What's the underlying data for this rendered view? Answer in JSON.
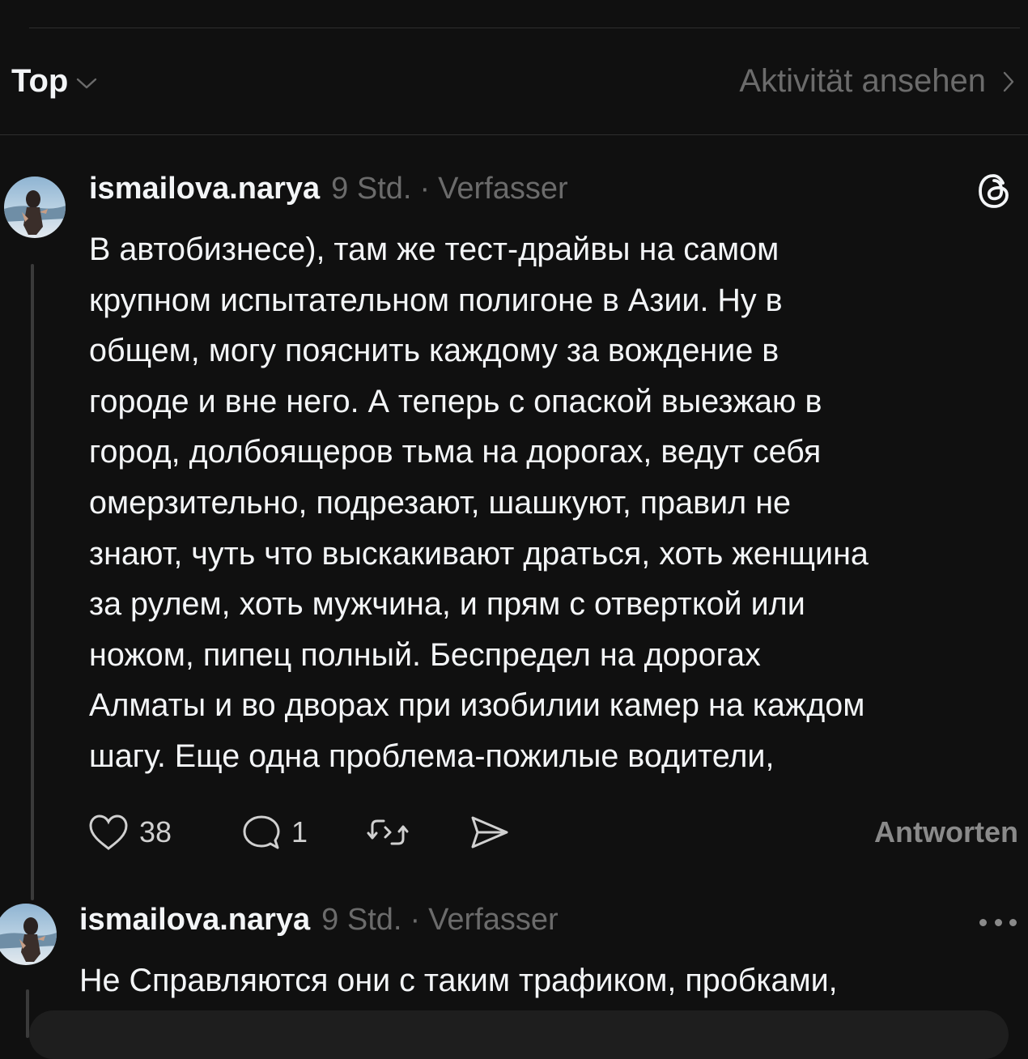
{
  "header": {
    "sort_label": "Top",
    "activity_label": "Aktivität ansehen"
  },
  "posts": [
    {
      "username": "ismailova.narya",
      "time": "9 Std.",
      "separator": "·",
      "role": "Verfasser",
      "text": "В автобизнесе), там же тест-драйвы на самом\nкрупном испытательном полигоне в Азии. Ну в\nобщем, могу пояснить каждому за вождение в\nгороде и вне него. А теперь с опаской выезжаю в\nгород, долбоящеров тьма на дорогах, ведут себя\nомерзительно, подрезают, шашкуют, правил не\nзнают, чуть что выскакивают драться, хоть женщина\nза рулем, хоть мужчина, и прям с отверткой или\nножом, пипец полный. Беспредел на дорогах\nАлматы и во дворах при изобилии камер на каждом\nшагу. Еще одна проблема-пожилые водители,",
      "likes": "38",
      "comments": "1",
      "reply_label": "Antworten"
    },
    {
      "username": "ismailova.narya",
      "time": "9 Std.",
      "separator": "·",
      "role": "Verfasser",
      "text": "Не Справляются они с таким трафиком, пробками,"
    }
  ],
  "icons": {
    "sort": "chevron-down-icon",
    "activity": "chevron-right-icon",
    "threads": "threads-logo-icon",
    "like": "heart-icon",
    "comment": "comment-icon",
    "repost": "repost-icon",
    "share": "send-icon",
    "more": "more-icon"
  },
  "colors": {
    "background": "#101010",
    "text_primary": "#f3f5f7",
    "text_secondary": "#6b6b6b"
  }
}
